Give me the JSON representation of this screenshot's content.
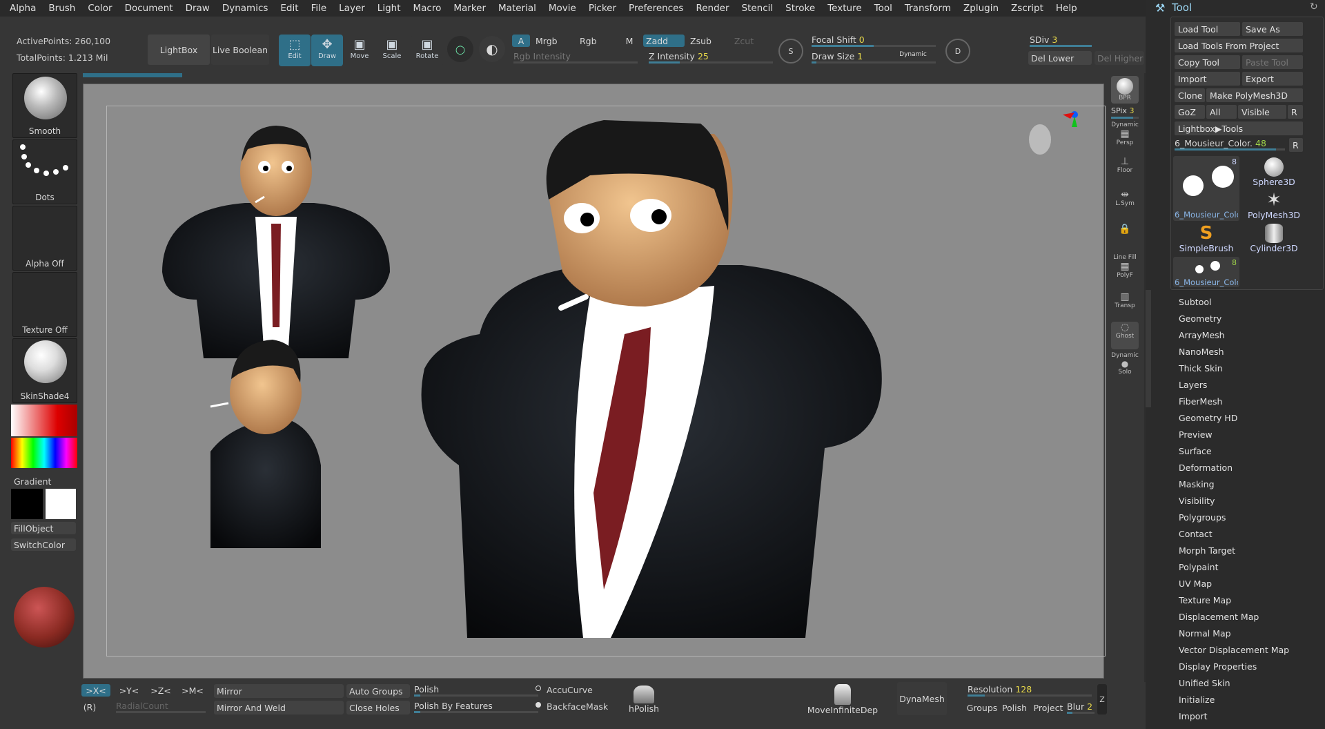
{
  "menu": [
    "Alpha",
    "Brush",
    "Color",
    "Document",
    "Draw",
    "Dynamics",
    "Edit",
    "File",
    "Layer",
    "Light",
    "Macro",
    "Marker",
    "Material",
    "Movie",
    "Picker",
    "Preferences",
    "Render",
    "Stencil",
    "Stroke",
    "Texture",
    "Tool",
    "Transform",
    "Zplugin",
    "Zscript",
    "Help"
  ],
  "stats": {
    "active": "ActivePoints: 260,100",
    "total": "TotalPoints: 1.213 Mil"
  },
  "topbar": {
    "lightbox": "LightBox",
    "live_boolean": "Live Boolean",
    "edit": "Edit",
    "draw": "Draw",
    "move": "Move",
    "scale": "Scale",
    "rotate": "Rotate",
    "a": "A",
    "mrgb": "Mrgb",
    "rgb": "Rgb",
    "m": "M",
    "zadd": "Zadd",
    "zsub": "Zsub",
    "zcut": "Zcut",
    "rgb_intensity": "Rgb Intensity",
    "z_intensity_label": "Z Intensity",
    "z_intensity_value": "25",
    "focal_shift_label": "Focal Shift",
    "focal_shift_value": "0",
    "draw_size_label": "Draw Size",
    "draw_size_value": "1",
    "dynamic": "Dynamic",
    "s_label": "S",
    "d_label": "D",
    "sdiv_label": "SDiv",
    "sdiv_value": "3",
    "del_lower": "Del Lower",
    "del_higher": "Del Higher"
  },
  "left": {
    "brush": "Smooth",
    "stroke": "Dots",
    "alpha": "Alpha Off",
    "texture": "Texture Off",
    "material": "SkinShade4",
    "gradient": "Gradient",
    "fillobject": "FillObject",
    "switchcolor": "SwitchColor"
  },
  "right_shelf": {
    "bpr": "BPR",
    "spix_label": "SPix",
    "spix_value": "3",
    "persp": "Persp",
    "persp_top": "Dynamic",
    "floor": "Floor",
    "lsym": "L.Sym",
    "linefill": "Line Fill",
    "polyf": "PolyF",
    "transp": "Transp",
    "ghost": "Ghost",
    "solo": "Solo",
    "solo_top": "Dynamic"
  },
  "bottom": {
    "x": ">X<",
    "y": ">Y<",
    "z": ">Z<",
    "m": ">M<",
    "r": "(R)",
    "radialcount": "RadialCount",
    "mirror": "Mirror",
    "mirror_weld": "Mirror And Weld",
    "auto_groups": "Auto Groups",
    "close_holes": "Close Holes",
    "polish": "Polish",
    "polish_features": "Polish By Features",
    "accucurve": "AccuCurve",
    "backfacemask": "BackfaceMask",
    "hpolish": "hPolish",
    "moveinfinite": "MoveInfiniteDep",
    "dynamesh": "DynaMesh",
    "resolution_label": "Resolution",
    "resolution_value": "128",
    "groups": "Groups",
    "polish2": "Polish",
    "project": "Project",
    "blur_label": "Blur",
    "blur_value": "2",
    "z_edge": "Z"
  },
  "toolpanel": {
    "title": "Tool",
    "load_tool": "Load Tool",
    "save_as": "Save As",
    "load_from_project": "Load Tools From Project",
    "copy_tool": "Copy Tool",
    "paste_tool": "Paste Tool",
    "import": "Import",
    "export": "Export",
    "clone": "Clone",
    "make_polymesh": "Make PolyMesh3D",
    "goz": "GoZ",
    "all": "All",
    "visible": "Visible",
    "r": "R",
    "lightbox_tools": "Lightbox▶Tools",
    "current_tool": "6_Mousieur_Color.",
    "current_tool_value": "48",
    "thumb1_label": "6_Mousieur_Colo",
    "thumb1_count": "8",
    "sphere": "Sphere3D",
    "polymesh": "PolyMesh3D",
    "simplebrush": "SimpleBrush",
    "cylinder": "Cylinder3D",
    "thumb2_label": "6_Mousieur_Colo",
    "thumb2_count": "8",
    "sections": [
      "Subtool",
      "Geometry",
      "ArrayMesh",
      "NanoMesh",
      "Thick Skin",
      "Layers",
      "FiberMesh",
      "Geometry HD",
      "Preview",
      "Surface",
      "Deformation",
      "Masking",
      "Visibility",
      "Polygroups",
      "Contact",
      "Morph Target",
      "Polypaint",
      "UV Map",
      "Texture Map",
      "Displacement Map",
      "Normal Map",
      "Vector Displacement Map",
      "Display Properties",
      "Unified Skin",
      "Initialize",
      "Import"
    ]
  },
  "colors": {
    "accent": "#3f7e96",
    "panel": "#363636",
    "canvas": "#8c8c8c"
  }
}
